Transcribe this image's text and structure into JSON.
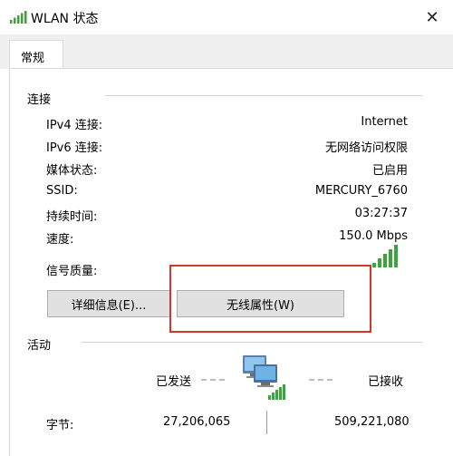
{
  "window": {
    "title": "WLAN 状态",
    "close_symbol": "✕"
  },
  "tabs": [
    {
      "label": "常规"
    }
  ],
  "connection": {
    "section_title": "连接",
    "rows": [
      {
        "label": "IPv4 连接:",
        "value": "Internet"
      },
      {
        "label": "IPv6 连接:",
        "value": "无网络访问权限"
      },
      {
        "label": "媒体状态:",
        "value": "已启用"
      },
      {
        "label": "SSID:",
        "value": "MERCURY_6760"
      },
      {
        "label": "持续时间:",
        "value": "03:27:37"
      },
      {
        "label": "速度:",
        "value": "150.0 Mbps"
      }
    ],
    "signal_label": "信号质量:",
    "signal_bars": 5,
    "signal_icon": "signal-strength-icon"
  },
  "buttons": {
    "details": "详细信息(E)...",
    "wireless_properties": "无线属性(W)"
  },
  "activity": {
    "section_title": "活动",
    "sent_label": "已发送",
    "received_label": "已接收",
    "bytes_label": "字节:",
    "bytes_sent": "27,206,065",
    "bytes_received": "509,221,080",
    "network_icon": "network-computers-icon"
  },
  "colors": {
    "signal_green": "#3aa53a",
    "highlight_red": "#d9342b",
    "tab_strip_bg": "#f0f0f0",
    "button_bg": "#e1e1e1"
  }
}
